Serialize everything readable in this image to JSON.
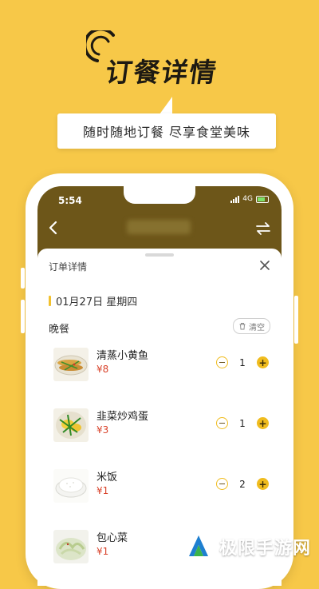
{
  "promo": {
    "title": "订餐详情",
    "tagline": "随时随地订餐   尽享食堂美味"
  },
  "status_bar": {
    "time": "5:54",
    "network": "4G"
  },
  "sheet": {
    "title": "订单详情",
    "date": "01月27日 星期四",
    "meal": "晚餐",
    "clear_label": "清空"
  },
  "items": [
    {
      "name": "清蒸小黄鱼",
      "price": "¥8",
      "qty": "1"
    },
    {
      "name": "韭菜炒鸡蛋",
      "price": "¥3",
      "qty": "1"
    },
    {
      "name": "米饭",
      "price": "¥1",
      "qty": "2"
    },
    {
      "name": "包心菜",
      "price": "¥1",
      "qty": ""
    }
  ],
  "watermark": {
    "text": "极限手游网"
  },
  "colors": {
    "background": "#F7C848",
    "header": "#6D5619",
    "accent": "#F0BC1E",
    "price": "#D9432B"
  }
}
